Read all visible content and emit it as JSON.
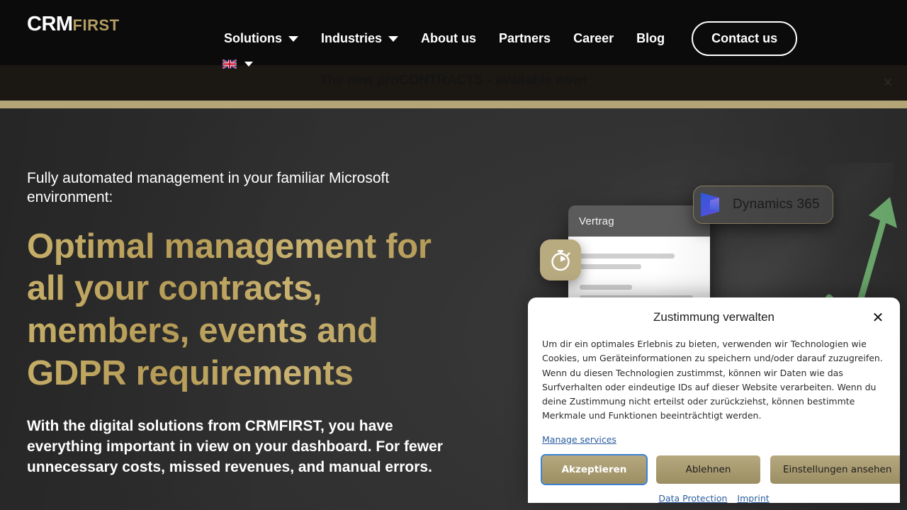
{
  "header": {
    "logo": {
      "primary": "CRM",
      "secondary": "FIRST"
    },
    "nav": [
      {
        "label": "Solutions",
        "has_caret": true
      },
      {
        "label": "Industries",
        "has_caret": true
      },
      {
        "label": "About us",
        "has_caret": false
      },
      {
        "label": "Partners",
        "has_caret": false
      },
      {
        "label": "Career",
        "has_caret": false
      },
      {
        "label": "Blog",
        "has_caret": false
      }
    ],
    "contact_label": "Contact us",
    "language": {
      "icon": "uk-flag-icon",
      "caret": "chevron-down-icon"
    }
  },
  "announcement": {
    "text": "The new proCONTRACTS - available now!",
    "close_label": "✕"
  },
  "hero": {
    "kicker": "Fully automated management in your familiar Microsoft environment:",
    "headline": "Optimal management for all your contracts, members, events and GDPR requirements",
    "subcopy": "With the digital solutions from CRMFIRST, you have everything important in view on your dashboard. For fewer unnecessary costs, missed revenues, and manual errors."
  },
  "illustration": {
    "document_title": "Vertrag",
    "dynamics_label": "Dynamics 365",
    "clock_icon": "stopwatch-icon",
    "dynamics_icon": "dynamics-365-logo-icon",
    "arrow_icon": "growth-arrow-icon"
  },
  "cookie": {
    "title": "Zustimmung verwalten",
    "close_label": "✕",
    "body": "Um dir ein optimales Erlebnis zu bieten, verwenden wir Technologien wie Cookies, um Geräteinformationen zu speichern und/oder darauf zuzugreifen. Wenn du diesen Technologien zustimmst, können wir Daten wie das Surfverhalten oder eindeutige IDs auf dieser Website verarbeiten. Wenn du deine Zustimmung nicht erteilst oder zurückziehst, können bestimmte Merkmale und Funktionen beeinträchtigt werden.",
    "manage_services": "Manage services",
    "accept_label": "Akzeptieren",
    "decline_label": "Ablehnen",
    "settings_label": "Einstellungen ansehen",
    "data_protection_label": "Data Protection",
    "imprint_label": "Imprint"
  },
  "colors": {
    "gold": "#b4a578",
    "headline_gold": "#b69e5c",
    "header_bg": "#0b0b0b",
    "hero_bg": "#333333",
    "announce_bg": "#1b1813",
    "link_blue": "#2a5d9e",
    "focus_blue": "#3b82d4",
    "arrow_green": "#7dc47e"
  }
}
